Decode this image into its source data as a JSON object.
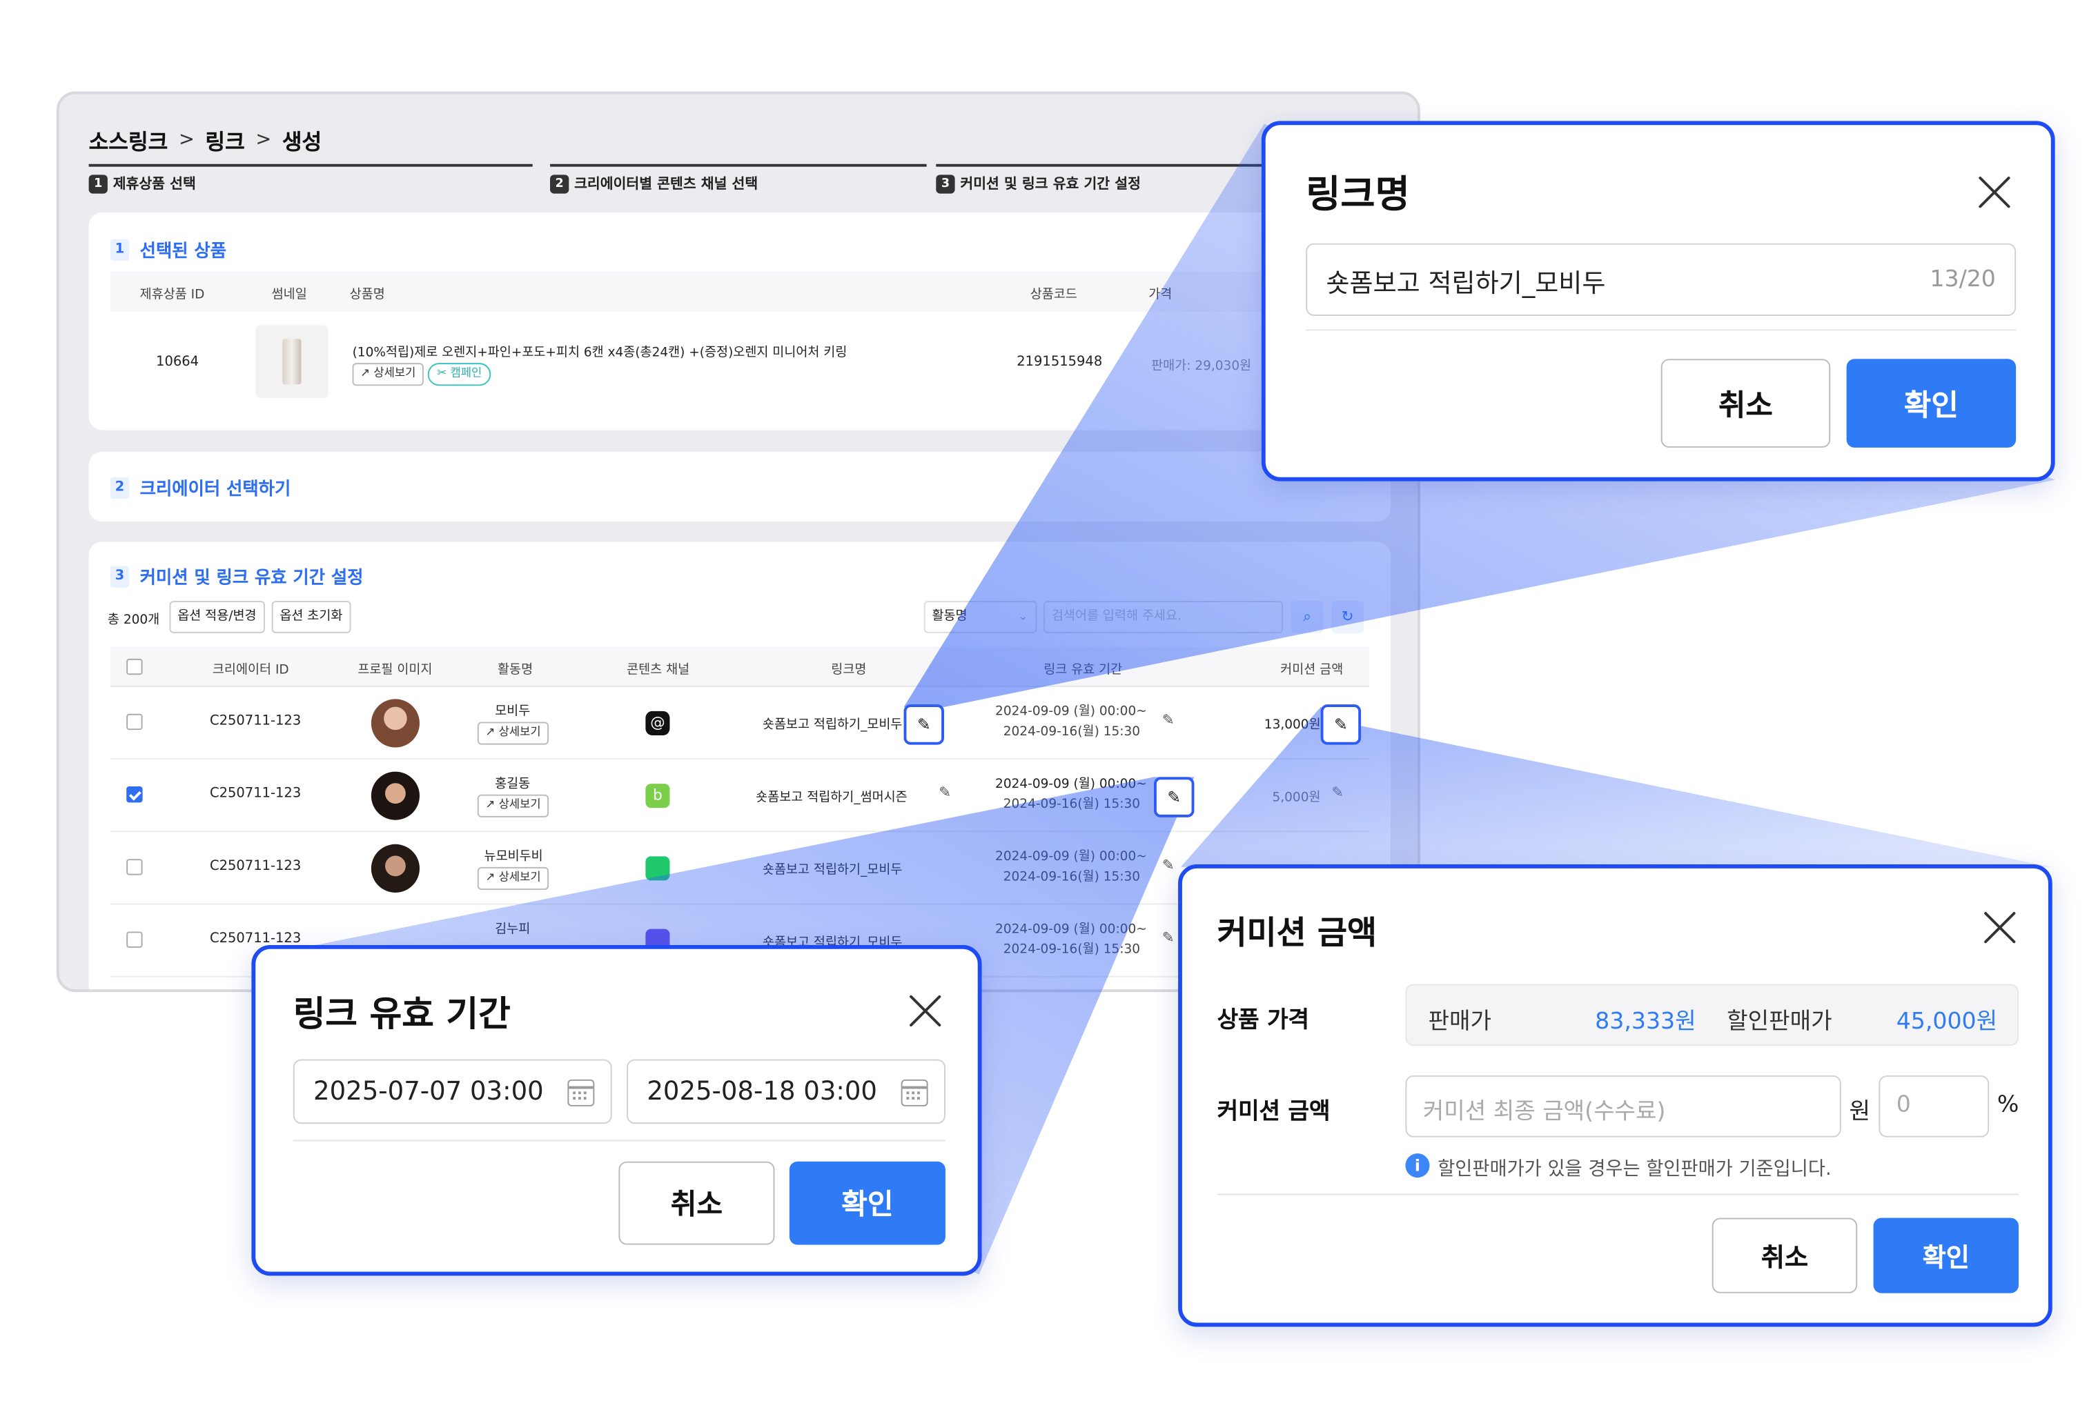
{
  "breadcrumb": [
    "소스링크",
    "링크",
    "생성"
  ],
  "breadcrumb_sep": ">",
  "steps": [
    {
      "num": "1",
      "label": "제휴상품 선택"
    },
    {
      "num": "2",
      "label": "크리에이터별 콘텐츠 채널 선택"
    },
    {
      "num": "3",
      "label": "커미션 및 링크 유효 기간 설정"
    }
  ],
  "section1": {
    "num": "1",
    "title": "선택된 상품",
    "headers": {
      "id": "제휴상품 ID",
      "thumb": "썸네일",
      "name": "상품명",
      "code": "상품코드",
      "price": "가격"
    },
    "product": {
      "id": "10664",
      "name": "(10%적립)제로 오렌지+파인+포도+피치 6캔 x4종(총24캔) +(증정)오렌지 미니어처 키링",
      "detail": "상세보기",
      "campaign": "캠페인",
      "code": "2191515948",
      "price": "판매가: 29,030원"
    }
  },
  "section2": {
    "num": "2",
    "title": "크리에이터 선택하기"
  },
  "section3": {
    "num": "3",
    "title": "커미션 및 링크 유효 기간 설정",
    "total": "총 200개",
    "apply_btn": "옵션 적용/변경",
    "reset_btn": "옵션 초기화",
    "filter_select": "활동명",
    "search_placeholder": "검색어를 입력해 주세요.",
    "headers": {
      "creator_id": "크리에이터 ID",
      "profile": "프로필 이미지",
      "activity": "활동명",
      "channel": "콘텐츠 채널",
      "link_name": "링크명",
      "period": "링크 유효 기간",
      "commission": "커미션 금액"
    },
    "rows": [
      {
        "checked": false,
        "id": "C250711-123",
        "activity": "모비두",
        "detail": "상세보기",
        "link": "숏폼보고 적립하기_모비두",
        "start": "2024-09-09 (월) 00:00~",
        "end": "2024-09-16(월) 15:30",
        "commission": "13,000원",
        "channel_color": "#111111"
      },
      {
        "checked": true,
        "id": "C250711-123",
        "activity": "홍길동",
        "detail": "상세보기",
        "link": "숏폼보고 적립하기_썸머시즌",
        "start": "2024-09-09 (월) 00:00~",
        "end": "2024-09-16(월) 15:30",
        "commission": "5,000원",
        "channel_color": "#7ccf4a"
      },
      {
        "checked": false,
        "id": "C250711-123",
        "activity": "뉴모비두비",
        "detail": "상세보기",
        "link": "숏폼보고 적립하기_모비두",
        "start": "2024-09-09 (월) 00:00~",
        "end": "2024-09-16(월) 15:30",
        "commission": "",
        "channel_color": "#1fc96b"
      },
      {
        "checked": false,
        "id": "C250711-123",
        "activity": "김누피",
        "detail": "",
        "link": "숏폼보고 적립하기_모비두",
        "start": "2024-09-09 (월) 00:00~",
        "end": "2024-09-16(월) 15:30",
        "commission": "",
        "channel_color": "#6b4de6"
      }
    ]
  },
  "modal_link_name": {
    "title": "링크명",
    "value": "숏폼보고 적립하기_모비두",
    "counter": "13/20",
    "cancel": "취소",
    "confirm": "확인"
  },
  "modal_period": {
    "title": "링크 유효 기간",
    "start": "2025-07-07 03:00",
    "end": "2025-08-18 03:00",
    "cancel": "취소",
    "confirm": "확인"
  },
  "modal_commission": {
    "title": "커미션 금액",
    "price_label": "상품 가격",
    "sale_label": "판매가",
    "sale_value": "83,333원",
    "discount_label": "할인판매가",
    "discount_value": "45,000원",
    "commission_label": "커미션 금액",
    "commission_placeholder": "커미션 최종 금액(수수료)",
    "won_unit": "원",
    "percent_placeholder": "0",
    "percent_unit": "%",
    "info": "할인판매가가 있을 경우는 할인판매가 기준입니다.",
    "cancel": "취소",
    "confirm": "확인"
  },
  "colors": {
    "accent": "#2f7bf6",
    "highlight_border": "#1f4cf2",
    "section_title": "#2e6ef0"
  },
  "icons": [
    "chevron-right-icon",
    "external-link-icon",
    "campaign-icon",
    "pencil-icon",
    "search-icon",
    "refresh-icon",
    "close-icon",
    "calendar-icon",
    "info-icon",
    "threads-icon",
    "naver-blog-icon",
    "channel-icon"
  ]
}
